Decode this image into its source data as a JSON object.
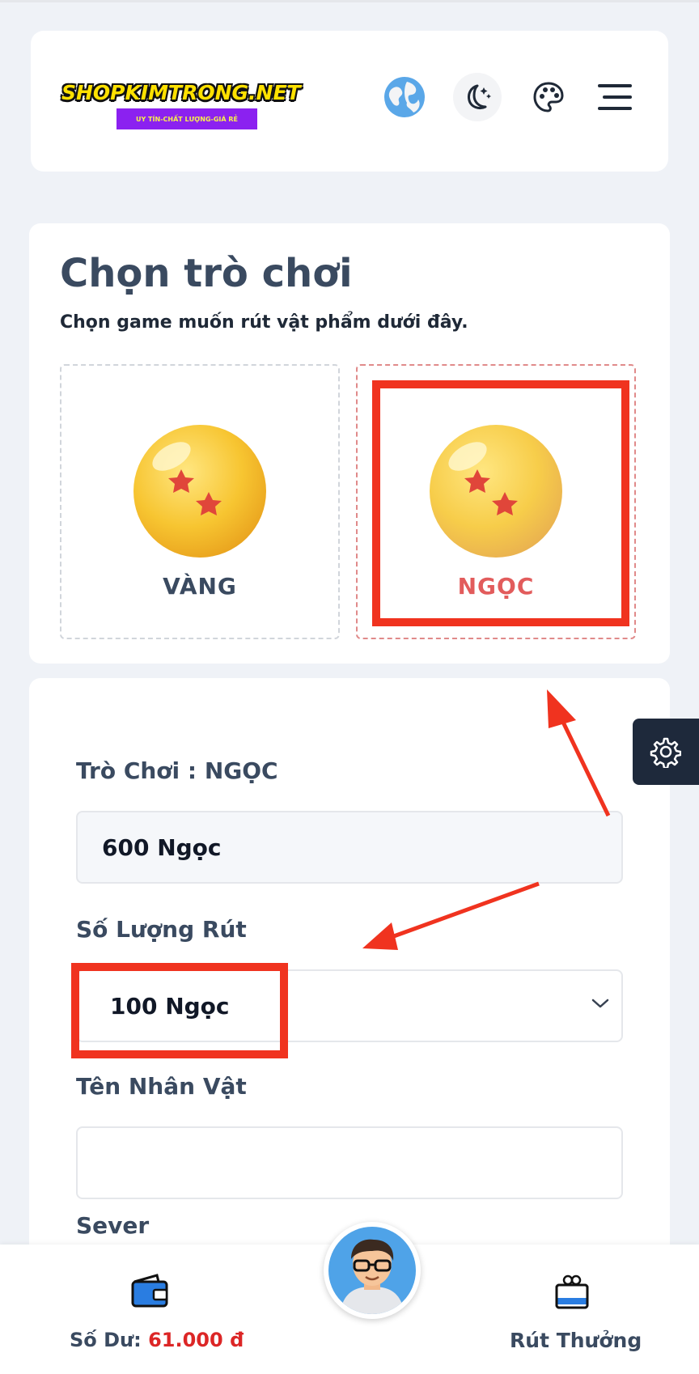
{
  "header": {
    "logo_text": "SHOPKIMTRONG.NET",
    "logo_tagline": "UY TÍN-CHẤT LƯỢNG-GIÁ RẺ",
    "icons": [
      "globe-icon",
      "moon-icon",
      "palette-icon",
      "menu-icon"
    ]
  },
  "game_select": {
    "title": "Chọn trò chơi",
    "subtitle": "Chọn game muốn rút vật phẩm dưới đây.",
    "options": [
      {
        "label": "VÀNG",
        "selected": false
      },
      {
        "label": "NGỌC",
        "selected": true
      }
    ]
  },
  "form": {
    "game_label": "Trò Chơi : NGỌC",
    "balance_value": "600 Ngọc",
    "amount_label": "Số Lượng Rút",
    "amount_selected": "100 Ngọc",
    "character_label": "Tên Nhân Vật",
    "character_value": "",
    "server_label": "Sever"
  },
  "bottom_nav": {
    "balance_label": "Số Dư:",
    "balance_amount": "61.000 đ",
    "reward_label": "Rút Thưởng"
  },
  "colors": {
    "accent_red": "#f0331f",
    "selected_text": "#e25c5c",
    "dark_tab": "#1e293b",
    "balance_amount": "#dc2626"
  }
}
